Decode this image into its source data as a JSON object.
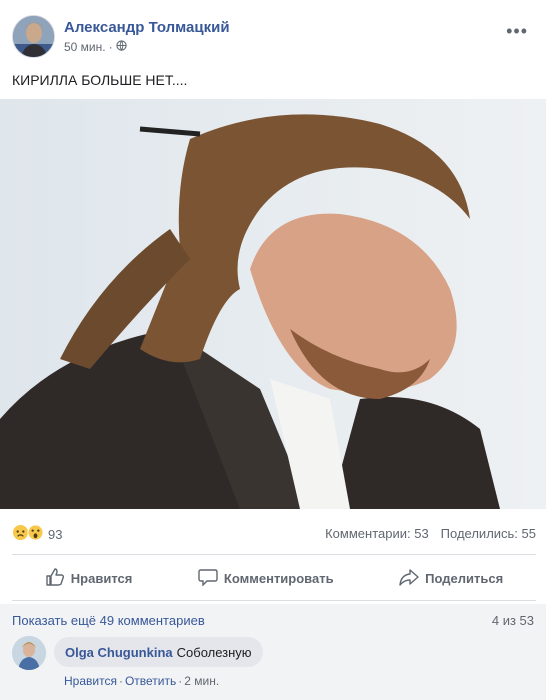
{
  "post": {
    "author": "Александр Толмацкий",
    "time": "50 мин.",
    "meta_separator": "·",
    "privacy_icon": "globe-icon",
    "more_label": "•••",
    "text": "КИРИЛЛА БОЛЬШЕ НЕТ...."
  },
  "stats": {
    "reaction_icons": [
      "sad-reaction-icon",
      "wow-reaction-icon"
    ],
    "reaction_count": "93",
    "comments": "Комментарии: 53",
    "shares": "Поделились: 55"
  },
  "actions": {
    "like": "Нравится",
    "comment": "Комментировать",
    "share": "Поделиться"
  },
  "comments": {
    "show_more": "Показать ещё 49 комментариев",
    "count": "4 из 53",
    "items": [
      {
        "author": "Olga Chugunkina",
        "text": "Соболезную",
        "like": "Нравится",
        "sep": " · ",
        "reply": "Ответить",
        "time": "2 мин."
      }
    ]
  },
  "colors": {
    "link": "#385898",
    "muted": "#606770",
    "divider": "#dadde1",
    "comment_bg": "#f2f3f5",
    "bubble_bg": "#e4e6eb"
  }
}
